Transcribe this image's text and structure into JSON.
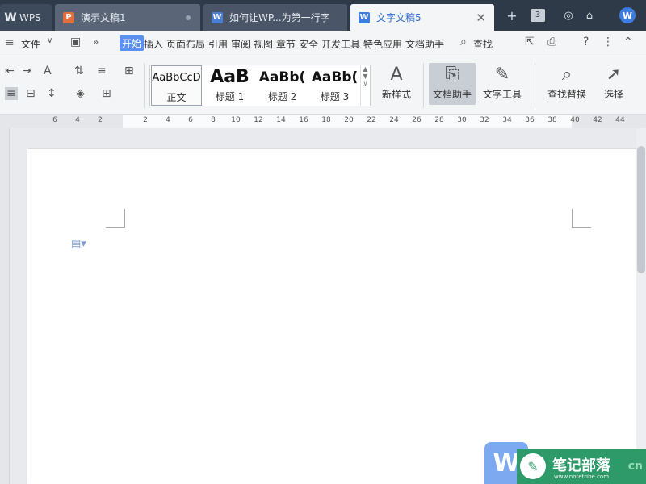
{
  "tabs": {
    "app": "WPS",
    "t1": "演示文稿1",
    "t2": "如何让WP...为第一行字",
    "t3": "文字文稿5",
    "window_count": "3"
  },
  "menu": {
    "file": "文件",
    "items": [
      "开始",
      "插入",
      "页面布局",
      "引用",
      "审阅",
      "视图",
      "章节",
      "安全",
      "开发工具",
      "特色应用",
      "文档助手"
    ],
    "search": "查找"
  },
  "ribbon": {
    "styles": [
      {
        "preview": "AaBbCcD",
        "name": "正文"
      },
      {
        "preview": "AaB",
        "name": "标题 1"
      },
      {
        "preview": "AaBb(",
        "name": "标题 2"
      },
      {
        "preview": "AaBb(",
        "name": "标题 3"
      }
    ],
    "new_style": "新样式",
    "doc_assistant": "文档助手",
    "text_tools": "文字工具",
    "find_replace": "查找替换",
    "select": "选择"
  },
  "ruler": {
    "ticks": [
      "6",
      "4",
      "2",
      "2",
      "4",
      "6",
      "8",
      "10",
      "12",
      "14",
      "16",
      "18",
      "20",
      "22",
      "24",
      "26",
      "28",
      "30",
      "32",
      "34",
      "36",
      "38",
      "40",
      "42",
      "44"
    ]
  },
  "watermark": {
    "logo": "W",
    "site": "笔记部落",
    "url": "www.notetribe.com",
    "suffix": "cn"
  }
}
